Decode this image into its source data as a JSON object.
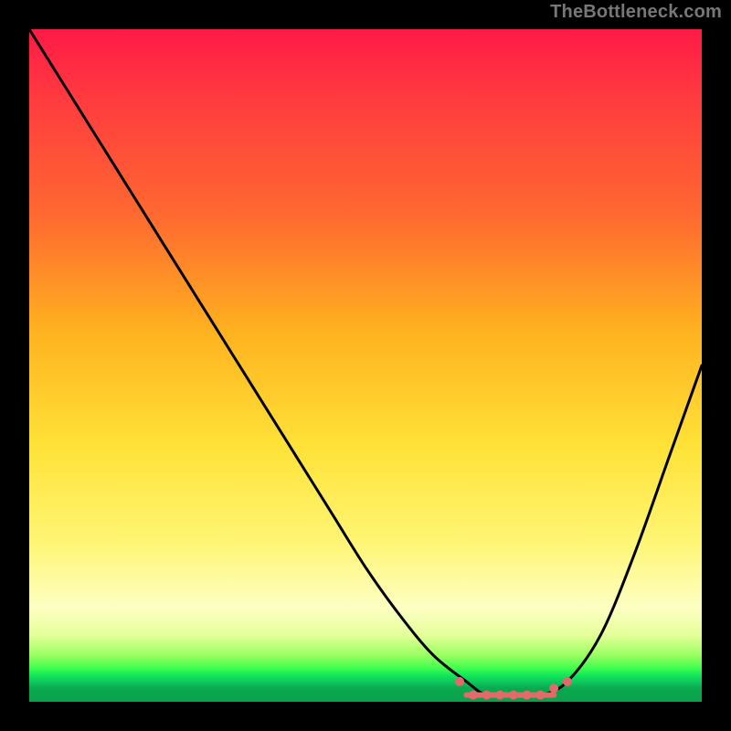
{
  "watermark": "TheBottleneck.com",
  "colors": {
    "background": "#000000",
    "curve": "#000000",
    "marker": "#e26a6a",
    "gradient_top": "#ff1a47",
    "gradient_mid": "#ffe238",
    "gradient_bottom": "#0aa24d"
  },
  "chart_data": {
    "type": "line",
    "title": "",
    "xlabel": "",
    "ylabel": "",
    "xlim": [
      0,
      100
    ],
    "ylim": [
      0,
      100
    ],
    "grid": false,
    "x": [
      0,
      5,
      10,
      15,
      20,
      25,
      30,
      35,
      40,
      45,
      50,
      55,
      60,
      65,
      68,
      72,
      76,
      80,
      85,
      90,
      95,
      100
    ],
    "values": [
      100,
      92,
      84,
      76,
      68,
      60,
      52,
      44,
      36,
      28,
      20,
      13,
      7,
      3,
      1,
      1,
      1,
      3,
      10,
      22,
      36,
      50
    ],
    "flat_region": {
      "x_start": 65,
      "x_end": 78,
      "y": 1
    },
    "markers": [
      {
        "x": 64,
        "y": 3
      },
      {
        "x": 66,
        "y": 1
      },
      {
        "x": 68,
        "y": 1
      },
      {
        "x": 70,
        "y": 1
      },
      {
        "x": 72,
        "y": 1
      },
      {
        "x": 74,
        "y": 1
      },
      {
        "x": 76,
        "y": 1
      },
      {
        "x": 78,
        "y": 2
      },
      {
        "x": 80,
        "y": 3
      }
    ]
  }
}
